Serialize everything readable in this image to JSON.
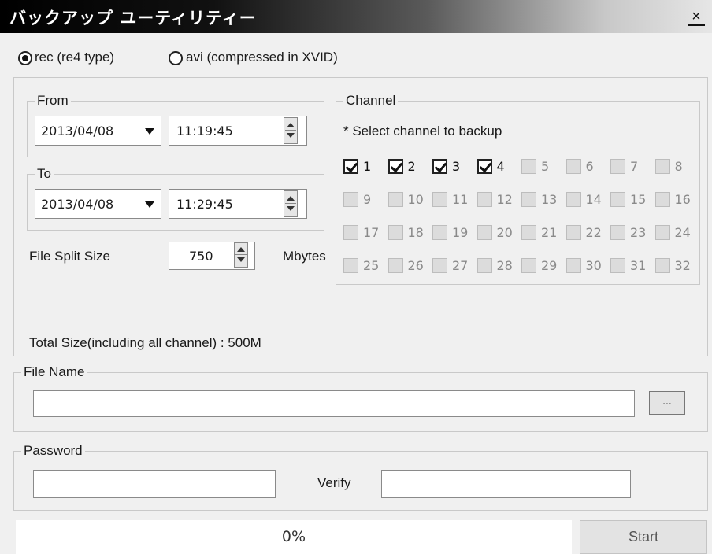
{
  "window": {
    "title": "バックアップ ユーティリティー",
    "close": "×"
  },
  "format": {
    "options": [
      {
        "label": "rec (re4 type)",
        "selected": true
      },
      {
        "label": "avi (compressed in XVID)",
        "selected": false
      }
    ]
  },
  "from": {
    "label": "From",
    "date": "2013/04/08",
    "time": "11:19:45"
  },
  "to": {
    "label": "To",
    "date": "2013/04/08",
    "time": "11:29:45"
  },
  "split": {
    "label": "File Split Size",
    "value": "750",
    "unit": "Mbytes"
  },
  "total": {
    "text": "Total Size(including all channel) : 500M"
  },
  "channel": {
    "label": "Channel",
    "hint": "* Select channel to backup",
    "items": [
      {
        "n": "1",
        "checked": true
      },
      {
        "n": "2",
        "checked": true
      },
      {
        "n": "3",
        "checked": true
      },
      {
        "n": "4",
        "checked": true
      },
      {
        "n": "5",
        "checked": false
      },
      {
        "n": "6",
        "checked": false
      },
      {
        "n": "7",
        "checked": false
      },
      {
        "n": "8",
        "checked": false
      },
      {
        "n": "9",
        "checked": false
      },
      {
        "n": "10",
        "checked": false
      },
      {
        "n": "11",
        "checked": false
      },
      {
        "n": "12",
        "checked": false
      },
      {
        "n": "13",
        "checked": false
      },
      {
        "n": "14",
        "checked": false
      },
      {
        "n": "15",
        "checked": false
      },
      {
        "n": "16",
        "checked": false
      },
      {
        "n": "17",
        "checked": false
      },
      {
        "n": "18",
        "checked": false
      },
      {
        "n": "19",
        "checked": false
      },
      {
        "n": "20",
        "checked": false
      },
      {
        "n": "21",
        "checked": false
      },
      {
        "n": "22",
        "checked": false
      },
      {
        "n": "23",
        "checked": false
      },
      {
        "n": "24",
        "checked": false
      },
      {
        "n": "25",
        "checked": false
      },
      {
        "n": "26",
        "checked": false
      },
      {
        "n": "27",
        "checked": false
      },
      {
        "n": "28",
        "checked": false
      },
      {
        "n": "29",
        "checked": false
      },
      {
        "n": "30",
        "checked": false
      },
      {
        "n": "31",
        "checked": false
      },
      {
        "n": "32",
        "checked": false
      }
    ]
  },
  "file": {
    "label": "File Name",
    "value": "",
    "browse": "..."
  },
  "password": {
    "label": "Password",
    "value": "",
    "verify_label": "Verify",
    "verify_value": ""
  },
  "progress": {
    "text": "0%",
    "fraction": 0
  },
  "start": {
    "label": "Start"
  },
  "icons": {
    "dropdown": "chevron-down-icon",
    "spinner": "spinner-arrows-icon",
    "checkbox": "checkbox-icon",
    "radio": "radio-icon"
  }
}
